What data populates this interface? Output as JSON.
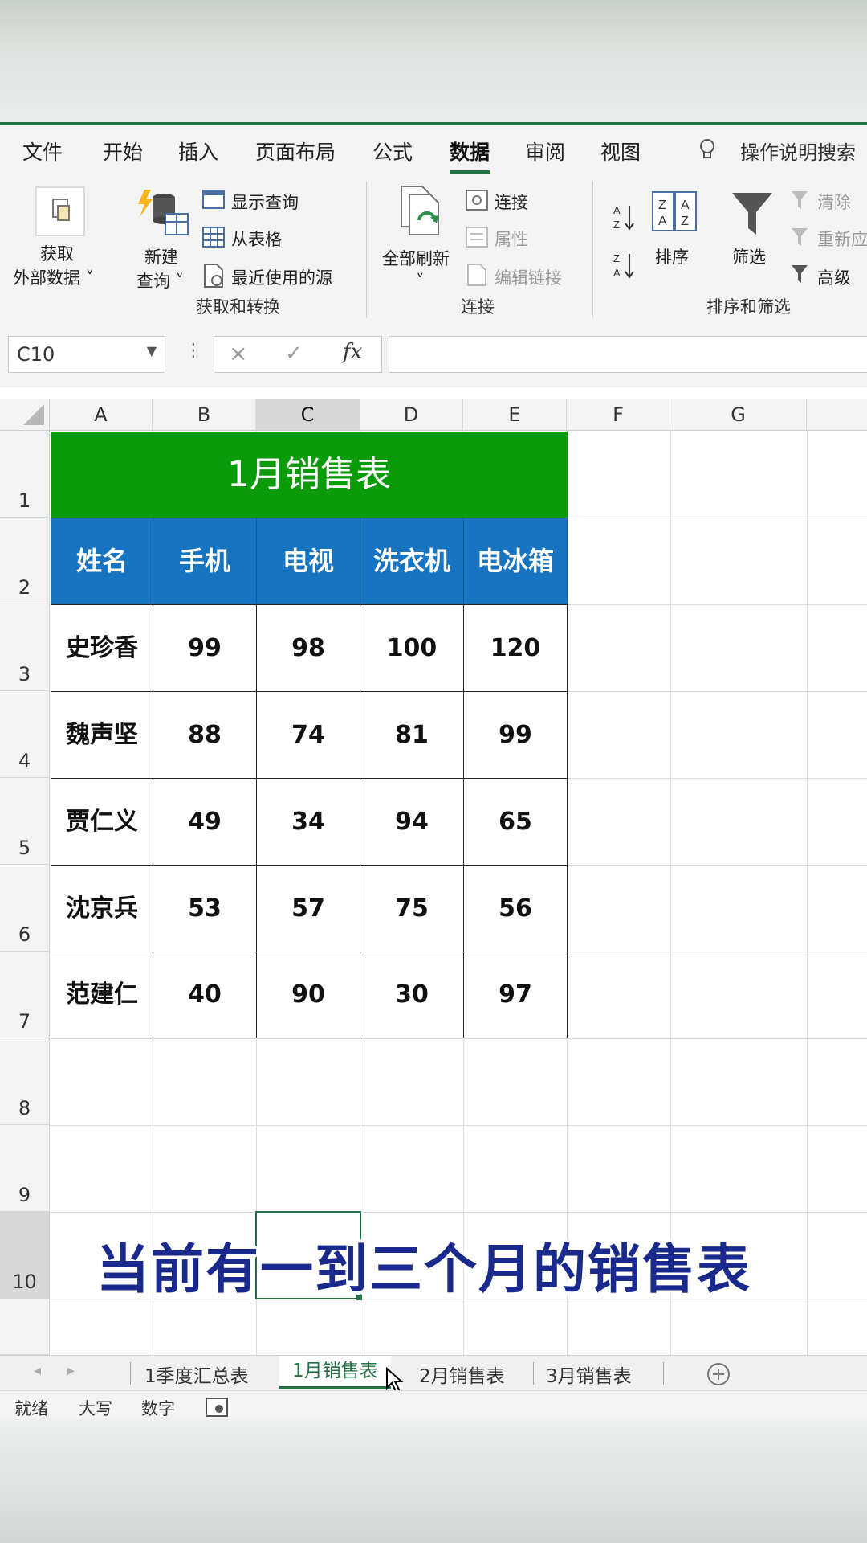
{
  "menu": {
    "tabs": [
      "文件",
      "开始",
      "插入",
      "页面布局",
      "公式",
      "数据",
      "审阅",
      "视图"
    ],
    "active": "数据",
    "tell_me": "操作说明搜索"
  },
  "ribbon": {
    "get_external": [
      "获取",
      "外部数据 ˅"
    ],
    "new_query": [
      "新建",
      "查询 ˅"
    ],
    "show_query": "显示查询",
    "from_table": "从表格",
    "recent_sources": "最近使用的源",
    "group_get_transform": "获取和转换",
    "refresh_all": "全部刷新",
    "refresh_caret": "˅",
    "connections": "连接",
    "properties": "属性",
    "edit_links": "编辑链接",
    "group_connections": "连接",
    "sort": "排序",
    "filter": "筛选",
    "clear": "清除",
    "reapply": "重新应",
    "advanced": "高级",
    "group_sort_filter": "排序和筛选"
  },
  "formula_bar": {
    "name_box": "C10",
    "cancel": "×",
    "enter": "✓",
    "fx": "fx",
    "formula": ""
  },
  "columns": [
    "A",
    "B",
    "C",
    "D",
    "E",
    "F",
    "G"
  ],
  "selected_column": "C",
  "rows": [
    "1",
    "2",
    "3",
    "4",
    "5",
    "6",
    "7",
    "8",
    "9",
    "10"
  ],
  "selected_row": "10",
  "table": {
    "title": "1月销售表",
    "headers": [
      "姓名",
      "手机",
      "电视",
      "洗衣机",
      "电冰箱"
    ],
    "data": [
      [
        "史珍香",
        "99",
        "98",
        "100",
        "120"
      ],
      [
        "魏声坚",
        "88",
        "74",
        "81",
        "99"
      ],
      [
        "贾仁义",
        "49",
        "34",
        "94",
        "65"
      ],
      [
        "沈京兵",
        "53",
        "57",
        "75",
        "56"
      ],
      [
        "范建仁",
        "40",
        "90",
        "30",
        "97"
      ]
    ]
  },
  "caption": "当前有一到三个月的销售表",
  "sheets": [
    "1季度汇总表",
    "1月销售表",
    "2月销售表",
    "3月销售表"
  ],
  "active_sheet": "1月销售表",
  "status": [
    "就绪",
    "大写",
    "数字"
  ],
  "colors": {
    "excel_green": "#217346",
    "title_green": "#0a9a0a",
    "header_blue": "#1674c0",
    "caption_blue": "#1a2a8c"
  }
}
